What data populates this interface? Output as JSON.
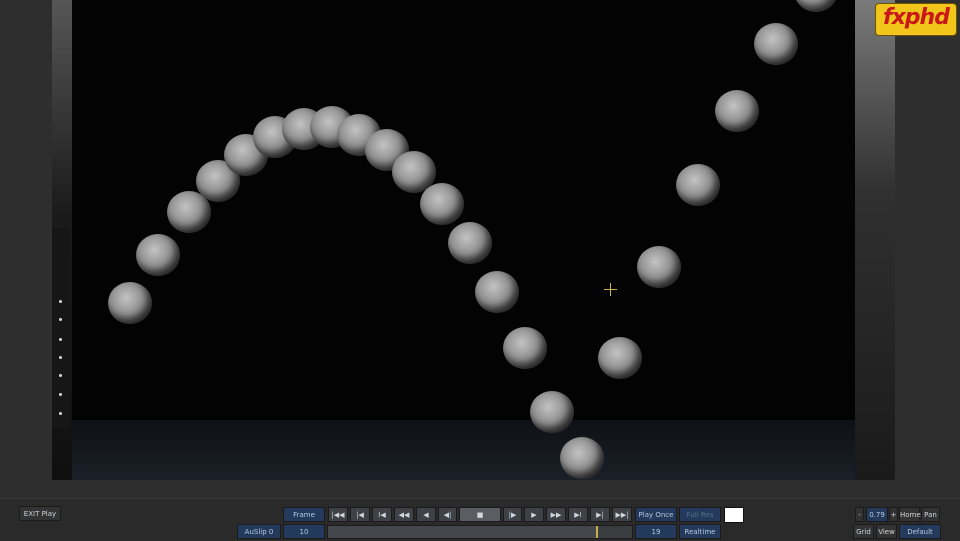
{
  "logo": {
    "text": "fxphd"
  },
  "transport": {
    "exit_label": "EXIT Play",
    "mode_label": "Frame",
    "play_mode_label": "Play Once",
    "full_res_label": "Full Res",
    "start_label": "AuSlip 0",
    "start_frame": "10",
    "current_frame": "19",
    "speed_label": "Realtime",
    "icons": [
      "first-frame-icon",
      "step-back-icon",
      "prev-key-icon",
      "rewind-icon",
      "play-reverse-icon",
      "step-reverse-icon",
      "stop-icon",
      "step-forward-icon",
      "play-forward-icon",
      "fast-forward-icon",
      "next-key-icon",
      "last-frame-icon"
    ],
    "timeline_position": 0.88
  },
  "view": {
    "zoom_minus": "-",
    "zoom_value": "0.79",
    "zoom_plus": "+",
    "home_label": "Home",
    "pan_label": "Pan",
    "grid_label": "Grid",
    "view_label": "View",
    "default_label": "Default"
  }
}
